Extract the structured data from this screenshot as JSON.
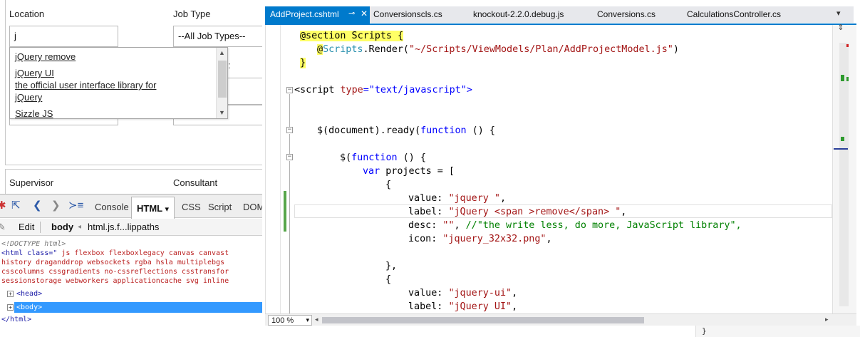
{
  "form": {
    "location_label": "Location",
    "job_type_label": "Job Type",
    "location_value": "j",
    "job_type_value": "--All Job Types--",
    "supervisor_label": "Supervisor",
    "consultant_label": "Consultant",
    "hidden_char": ":",
    "autocomplete": [
      "jQuery remove",
      "jQuery UI",
      "the official user interface library for",
      "jQuery",
      "Sizzle JS"
    ]
  },
  "firebug": {
    "tabs": [
      "Console",
      "HTML",
      "CSS",
      "Script",
      "DOM"
    ],
    "html_tab_arrow": "▾",
    "breadcrumb": {
      "edit": "Edit",
      "body": "body",
      "path": "html.js.f...lippaths"
    },
    "dom": {
      "doctype": "<!DOCTYPE html>",
      "html_open": "<html class=\"",
      "html_classes_1": " js flexbox flexboxlegacy canvas canvast",
      "html_classes_2": "history draganddrop websockets rgba hsla multiplebgs",
      "html_classes_3": "csscolumns cssgradients no-cssreflections csstransfor",
      "html_classes_4": "sessionstorage webworkers applicationcache svg inline",
      "head": "<head>",
      "body": "<body>",
      "html_close": "</html>"
    }
  },
  "vs": {
    "tabs": {
      "active": "AddProject.cshtml",
      "others": [
        "Conversionscls.cs",
        "knockout-2.2.0.debug.js",
        "Conversions.cs",
        "CalculationsController.cs"
      ]
    },
    "code": {
      "l1a": "@section",
      "l1b": " Scripts {",
      "l2a": "@",
      "l2b": "Scripts",
      "l2c": ".Render(",
      "l2d": "\"~/Scripts/ViewModels/Plan/AddProjectModel.js\"",
      "l2e": ")",
      "l3": "}",
      "l4a": "<script ",
      "l4b": "type",
      "l4c": "=\"text/javascript\">",
      "l5a": "$(document).ready(",
      "l5b": "function",
      "l5c": " () {",
      "l6a": "$(",
      "l6b": "function",
      "l6c": " () {",
      "l7a": "var",
      "l7b": " projects = [",
      "l8": "{",
      "l9a": "value: ",
      "l9b": "\"jquery \"",
      "l9c": ",",
      "l10a": "label: ",
      "l10b": "\"jQuery <span >remove</span> \"",
      "l10c": ",",
      "l11a": "desc: ",
      "l11b": "\"\"",
      "l11c": ", ",
      "l11d": "//\"the write less, do more, JavaScript library\",",
      "l12a": "icon: ",
      "l12b": "\"jquery_32x32.png\"",
      "l12c": ",",
      "l13": "},",
      "l14": "{",
      "l15a": "value: ",
      "l15b": "\"jquery-ui\"",
      "l15c": ",",
      "l16a": "label: ",
      "l16b": "\"jQuery UI\"",
      "l16c": ","
    },
    "zoom": "100 %",
    "bottom_brace": "}"
  }
}
